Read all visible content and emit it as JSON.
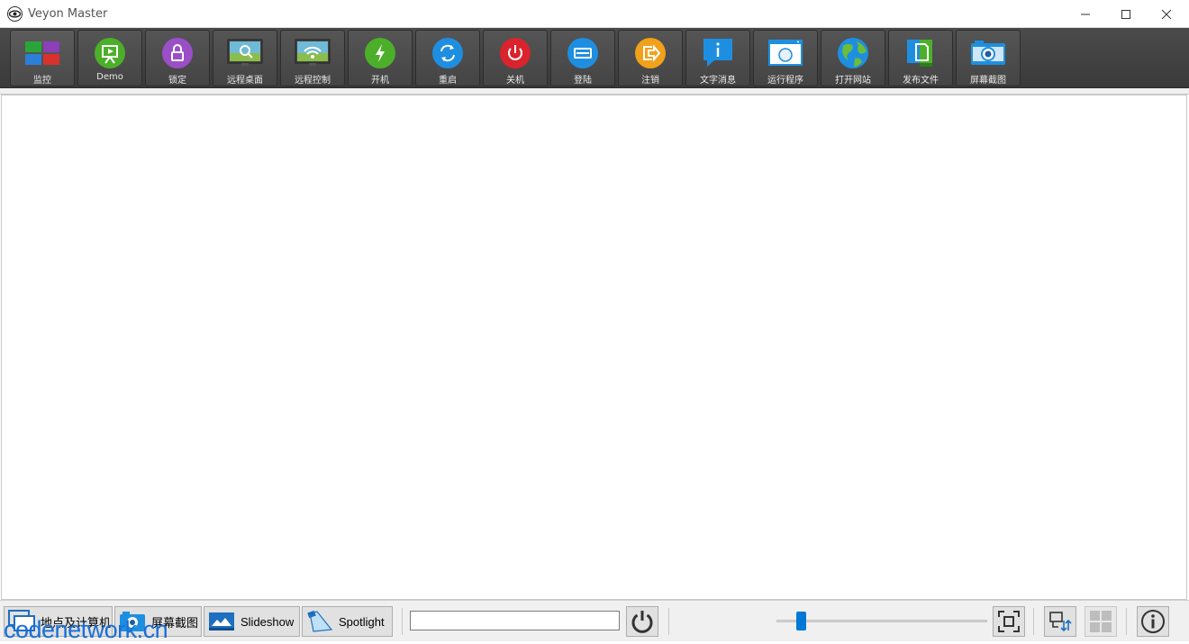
{
  "window": {
    "title": "Veyon Master",
    "icon": "eye-icon"
  },
  "toolbar": {
    "items": [
      {
        "label": "监控",
        "icon": "monitoring-icon",
        "active": true
      },
      {
        "label": "Demo",
        "icon": "demo-presentation-icon"
      },
      {
        "label": "锁定",
        "icon": "lock-icon"
      },
      {
        "label": "远程桌面",
        "icon": "remote-view-icon"
      },
      {
        "label": "远程控制",
        "icon": "remote-control-icon"
      },
      {
        "label": "开机",
        "icon": "power-on-icon"
      },
      {
        "label": "重启",
        "icon": "reboot-icon"
      },
      {
        "label": "关机",
        "icon": "power-off-icon"
      },
      {
        "label": "登陆",
        "icon": "login-icon"
      },
      {
        "label": "注销",
        "icon": "logout-icon"
      },
      {
        "label": "文字消息",
        "icon": "text-message-icon"
      },
      {
        "label": "运行程序",
        "icon": "run-program-icon"
      },
      {
        "label": "打开网站",
        "icon": "open-website-icon"
      },
      {
        "label": "发布文件",
        "icon": "file-transfer-icon"
      },
      {
        "label": "屏幕截图",
        "icon": "screenshot-icon"
      }
    ]
  },
  "statusbar": {
    "buttons": [
      {
        "label": "地点及计算机",
        "icon": "computers-icon"
      },
      {
        "label": "屏幕截图",
        "icon": "screenshot-icon"
      },
      {
        "label": "Slideshow",
        "icon": "slideshow-icon"
      },
      {
        "label": "Spotlight",
        "icon": "spotlight-icon"
      }
    ],
    "filter_value": "",
    "zoom_slider_level": 0.1
  },
  "watermark": "codenetwork.cn",
  "colors": {
    "accent": "#0078d7",
    "toolbar_bg": "#404040"
  }
}
